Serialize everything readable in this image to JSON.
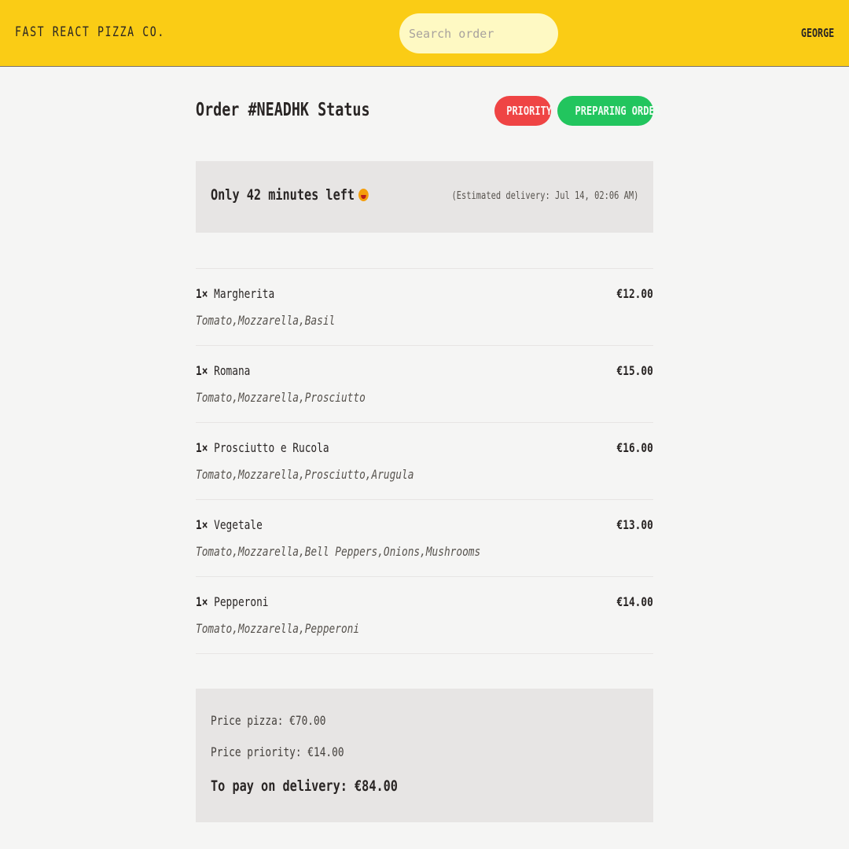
{
  "header": {
    "logo": "FAST REACT PIZZA CO.",
    "search_placeholder": "Search order",
    "username": "GEORGE",
    "background_color": "#facc15"
  },
  "order": {
    "title": "Order #NEADHK Status",
    "badges": {
      "priority": "PRIORITY",
      "status": "PREPARING ORDER",
      "priority_color": "#ef4444",
      "status_color": "#22c55e"
    },
    "time_left": "Only 42 minutes left",
    "time_left_icon": "grinning-face-emoji-icon",
    "estimated_delivery": "(Estimated delivery: Jul 14, 02:06 AM)"
  },
  "items": [
    {
      "qty": "1×",
      "name": "Margherita",
      "price": "€12.00",
      "ingredients": "Tomato,Mozzarella,Basil"
    },
    {
      "qty": "1×",
      "name": "Romana",
      "price": "€15.00",
      "ingredients": "Tomato,Mozzarella,Prosciutto"
    },
    {
      "qty": "1×",
      "name": "Prosciutto e Rucola",
      "price": "€16.00",
      "ingredients": "Tomato,Mozzarella,Prosciutto,Arugula"
    },
    {
      "qty": "1×",
      "name": "Vegetale",
      "price": "€13.00",
      "ingredients": "Tomato,Mozzarella,Bell Peppers,Onions,Mushrooms"
    },
    {
      "qty": "1×",
      "name": "Pepperoni",
      "price": "€14.00",
      "ingredients": "Tomato,Mozzarella,Pepperoni"
    }
  ],
  "summary": {
    "price_pizza": "Price pizza: €70.00",
    "price_priority": "Price priority: €14.00",
    "to_pay": "To pay on delivery: €84.00"
  }
}
